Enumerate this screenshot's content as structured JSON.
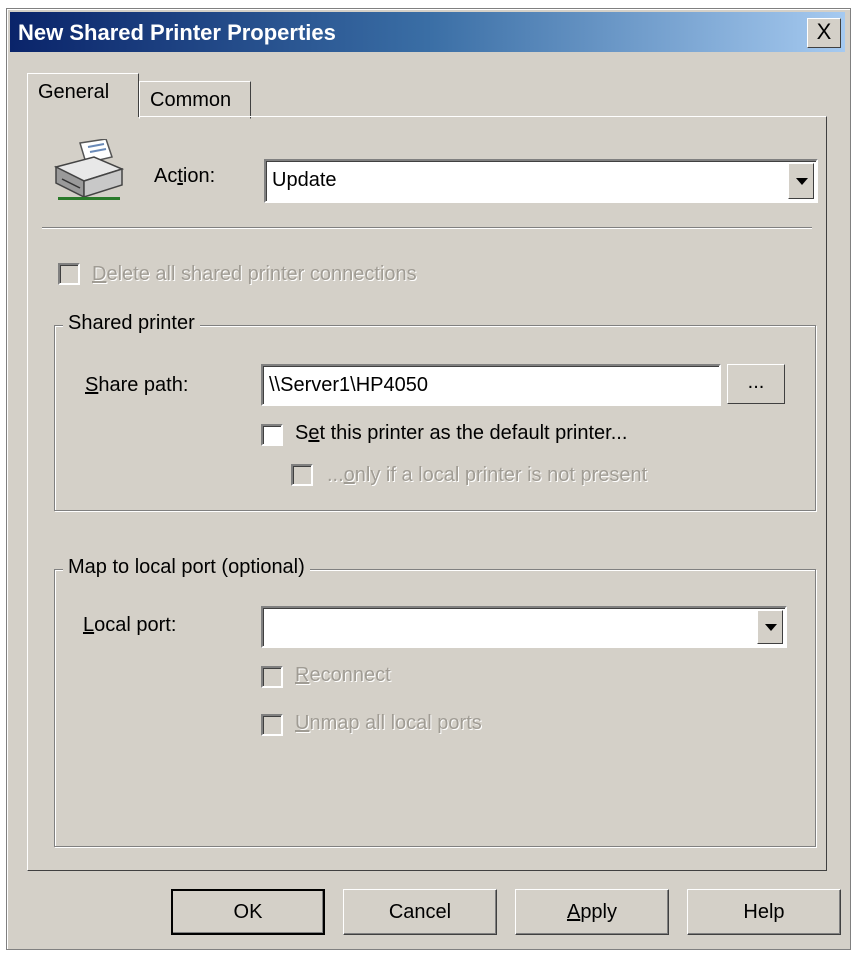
{
  "window": {
    "title": "New Shared Printer Properties",
    "close_label": "X"
  },
  "tabs": [
    {
      "label": "General",
      "active": true
    },
    {
      "label": "Common",
      "active": false
    }
  ],
  "general": {
    "action": {
      "label_pre": "Ac",
      "label_ul": "t",
      "label_post": "ion:",
      "value": "Update"
    },
    "delete_all": {
      "label_ul": "D",
      "label_post": "elete all shared printer connections",
      "checked": false,
      "enabled": false
    },
    "shared_printer": {
      "legend": "Shared printer",
      "share_path": {
        "label_ul": "S",
        "label_post": "hare path:",
        "value": "\\\\Server1\\HP4050"
      },
      "browse_label": "...",
      "set_default": {
        "label_pre": "S",
        "label_ul": "e",
        "label_post": "t this printer as the default printer...",
        "checked": false
      },
      "only_if_local": {
        "label_pre": "...",
        "label_ul": "o",
        "label_post": "nly if a local printer is not present",
        "checked": false,
        "enabled": false
      }
    },
    "map_port": {
      "legend": "Map to local port (optional)",
      "local_port": {
        "label_ul": "L",
        "label_post": "ocal port:",
        "value": ""
      },
      "reconnect": {
        "label_ul": "R",
        "label_post": "econnect",
        "checked": false,
        "enabled": false
      },
      "unmap_all": {
        "label_ul": "U",
        "label_post": "nmap all local ports",
        "checked": false,
        "enabled": false
      }
    }
  },
  "buttons": {
    "ok": "OK",
    "cancel": "Cancel",
    "apply_ul": "A",
    "apply_post": "pply",
    "help": "Help"
  },
  "colors": {
    "face": "#d4d0c8",
    "title_start": "#0a246a",
    "title_end": "#a6caf0",
    "disabled_text": "#a09c94"
  }
}
